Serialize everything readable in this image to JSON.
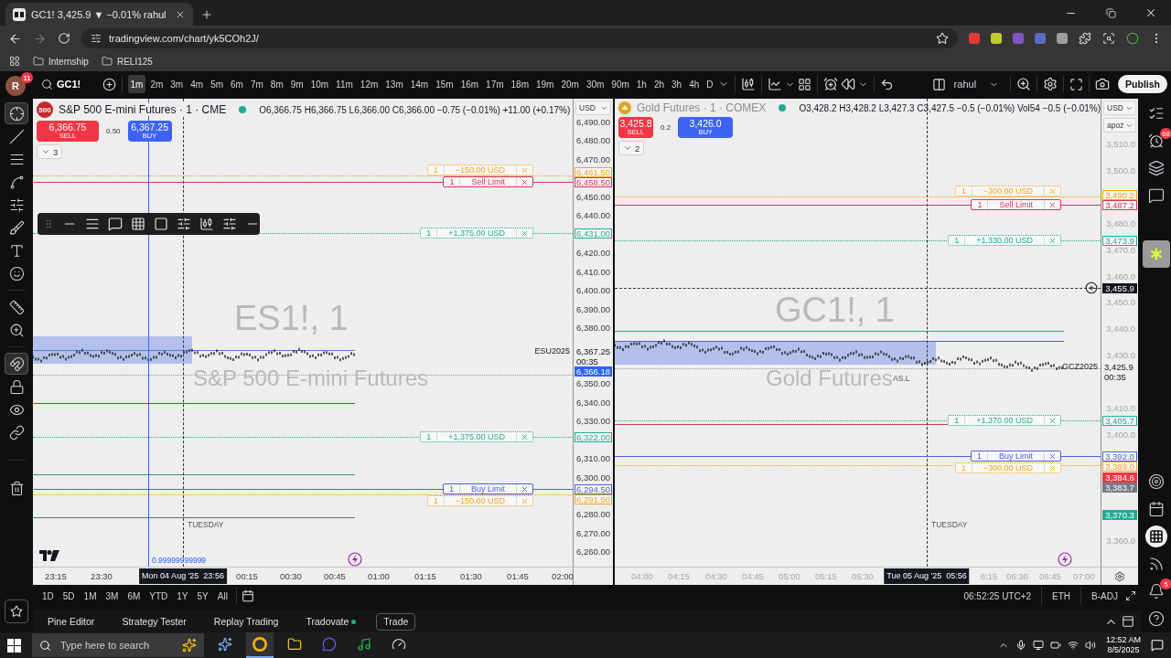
{
  "browser": {
    "tab": {
      "title": "GC1! 3,425.9 ▼ −0.01% rahul"
    },
    "url": "tradingview.com/chart/yk5COh2J/",
    "bookmarks": [
      {
        "label": "Internship"
      },
      {
        "label": "RELI125"
      }
    ]
  },
  "toolbar": {
    "avatar": "R",
    "avatar_badge": "11",
    "symbol": "GC1!",
    "layout_name": "rahul",
    "publish": "Publish",
    "intervals": [
      {
        "label": "1m",
        "selected": true
      },
      {
        "label": "2m",
        "selected": false
      },
      {
        "label": "3m",
        "selected": false
      },
      {
        "label": "4m",
        "selected": false
      },
      {
        "label": "5m",
        "selected": false
      },
      {
        "label": "6m",
        "selected": false
      },
      {
        "label": "7m",
        "selected": false
      },
      {
        "label": "8m",
        "selected": false
      },
      {
        "label": "9m",
        "selected": false
      },
      {
        "label": "10m",
        "selected": false
      },
      {
        "label": "11m",
        "selected": false
      },
      {
        "label": "12m",
        "selected": false
      },
      {
        "label": "13m",
        "selected": false
      },
      {
        "label": "14m",
        "selected": false
      },
      {
        "label": "15m",
        "selected": false
      },
      {
        "label": "16m",
        "selected": false
      },
      {
        "label": "17m",
        "selected": false
      },
      {
        "label": "18m",
        "selected": false
      },
      {
        "label": "19m",
        "selected": false
      },
      {
        "label": "20m",
        "selected": false
      },
      {
        "label": "30m",
        "selected": false
      },
      {
        "label": "90m",
        "selected": false
      },
      {
        "label": "1h",
        "selected": false
      },
      {
        "label": "2h",
        "selected": false
      },
      {
        "label": "3h",
        "selected": false
      },
      {
        "label": "4h",
        "selected": false
      },
      {
        "label": "D",
        "selected": false
      }
    ]
  },
  "drawing_tools": [
    {
      "kind": "crosshair",
      "selected": true
    },
    {
      "kind": "trend-line",
      "selected": false
    },
    {
      "kind": "channels",
      "selected": false
    },
    {
      "kind": "pattern",
      "selected": false
    },
    {
      "kind": "position",
      "selected": false
    },
    {
      "kind": "brush",
      "selected": false
    },
    {
      "kind": "text",
      "selected": false
    },
    {
      "kind": "emoji",
      "selected": false
    },
    {
      "kind": "ruler",
      "selected": false
    },
    {
      "kind": "zoom",
      "selected": false
    },
    {
      "kind": "magnet",
      "selected": true
    },
    {
      "kind": "lock",
      "selected": false
    },
    {
      "kind": "eye",
      "selected": false
    },
    {
      "kind": "link",
      "selected": false
    },
    {
      "kind": "trash",
      "selected": false
    }
  ],
  "right_sidebar": [
    {
      "kind": "watchlist",
      "selected": false
    },
    {
      "kind": "alerts",
      "badge": "68",
      "selected": false
    },
    {
      "kind": "layers",
      "selected": false
    },
    {
      "kind": "chat",
      "selected": false
    },
    {
      "kind": "app",
      "selected": true
    },
    {
      "kind": "target",
      "selected": false
    },
    {
      "kind": "calendar",
      "selected": false
    },
    {
      "kind": "apps",
      "selected": false
    },
    {
      "kind": "signal",
      "selected": false
    },
    {
      "kind": "notifications",
      "badge": "5",
      "selected": false
    },
    {
      "kind": "help",
      "selected": false
    }
  ],
  "charts": [
    {
      "active": true,
      "logo": "500",
      "title": "S&P 500 E-mini Futures · 1 · CME",
      "market_open": true,
      "ohlc": "O6,366.75 H6,366.75 L6,366.00 C6,366.00 −0.75 (−0.01%) +11.00 (+0.17%)",
      "sell": {
        "price": "6,366.75",
        "label": "SELL"
      },
      "spread": "0.50",
      "buy": {
        "price": "6,367.25",
        "label": "BUY"
      },
      "indicator_count": "3",
      "axis_menus": [
        "USD"
      ],
      "watermark": {
        "symbol": "ES1!, 1",
        "name": "S&P 500 E-mini Futures"
      },
      "price_ticks": [
        "6,490.00",
        "6,480.00",
        "6,470.00",
        "6,450.00",
        "6,440.00",
        "6,420.00",
        "6,410.00",
        "6,400.00",
        "6,390.00",
        "6,380.00",
        "6,350.00",
        "6,340.00",
        "6,330.00",
        "6,310.00",
        "6,300.00",
        "6,280.00",
        "6,270.00",
        "6,260.00"
      ],
      "price_tags": [
        {
          "text": "6,461.50",
          "color": "#f7a21b",
          "filled": false
        },
        {
          "text": "6,458.50",
          "color": "#d8365a",
          "filled": false
        },
        {
          "text": "6,431.00",
          "color": "#22ab94",
          "filled": false
        },
        {
          "text": "6,366.18",
          "color": "#2962ff",
          "filled": true
        },
        {
          "text": "6,322.00",
          "color": "#22ab94",
          "filled": false
        },
        {
          "text": "6,294.50",
          "color": "#4a64d6",
          "filled": false
        },
        {
          "text": "6,291.50",
          "color": "#f7a21b",
          "filled": false
        }
      ],
      "last_price": {
        "symbol": "ESU2025",
        "price": "6,367.25",
        "countdown": "00:35"
      },
      "orders": [
        {
          "kind": "bracket",
          "quantity": "1",
          "text": "−150.00 USD",
          "color": "#f7a21b"
        },
        {
          "kind": "limit",
          "quantity": "1",
          "text": "Sell Limit",
          "color": "#d8365a"
        },
        {
          "kind": "bracket",
          "quantity": "1",
          "text": "+1,375.00 USD",
          "color": "#22ab94"
        },
        {
          "kind": "bracket",
          "quantity": "1",
          "text": "+1,375.00 USD",
          "color": "#22ab94"
        },
        {
          "kind": "limit",
          "quantity": "1",
          "text": "Buy Limit",
          "color": "#4a64d6"
        },
        {
          "kind": "bracket",
          "quantity": "1",
          "text": "−150.00 USD",
          "color": "#f7a21b"
        }
      ],
      "notes": [
        {
          "kind": "label",
          "text": "TUESDAY"
        },
        {
          "kind": "level",
          "text": "0.99999999999"
        }
      ],
      "time_ticks": [
        "23:15",
        "23:30",
        "00:15",
        "00:30",
        "00:45",
        "01:00",
        "01:15",
        "01:30",
        "01:45",
        "02:00"
      ],
      "crosshair_time": "Mon 04 Aug '25  23:56"
    },
    {
      "active": false,
      "title": "Gold Futures · 1 · COMEX",
      "market_open": true,
      "ohlc": "O3,428.2 H3,428.2 L3,427.3 C3,427.5 −0.5 (−0.01%) Vol54 −0.5 (−0.01%)",
      "sell": {
        "price": "3,425.8",
        "label": "SELL"
      },
      "spread": "0.2",
      "buy": {
        "price": "3,426.0",
        "label": "BUY"
      },
      "indicator_count": "2",
      "axis_menus": [
        "USD",
        "apoz"
      ],
      "watermark": {
        "symbol": "GC1!, 1",
        "name": "Gold Futures"
      },
      "price_ticks": [
        "3,510.0",
        "3,500.0",
        "3,480.0",
        "3,470.0",
        "3,460.0",
        "3,450.0",
        "3,440.0",
        "3,430.0",
        "3,410.0",
        "3,400.0",
        "3,360.0"
      ],
      "price_tags": [
        {
          "text": "3,490.2",
          "color": "#f7a21b",
          "filled": false
        },
        {
          "text": "3,487.2",
          "color": "#d8365a",
          "filled": false
        },
        {
          "text": "3,473.9",
          "color": "#22ab94",
          "filled": false
        },
        {
          "text": "3,455.9",
          "color": "#131722",
          "filled": true
        },
        {
          "text": "3,405.7",
          "color": "#22ab94",
          "filled": false
        },
        {
          "text": "3,392.0",
          "color": "#4a64d6",
          "filled": false
        },
        {
          "text": "3,389.0",
          "color": "#f7a21b",
          "filled": false
        },
        {
          "text": "3,384.6",
          "color": "#f23645",
          "filled": true
        },
        {
          "text": "3,383.7",
          "color": "#787b86",
          "filled": true
        },
        {
          "text": "3,370.3",
          "color": "#22ab94",
          "filled": true
        }
      ],
      "last_price": {
        "symbol": "GCZ2025",
        "price": "3,425.9",
        "countdown": "00:35"
      },
      "orders": [
        {
          "kind": "bracket",
          "quantity": "1",
          "text": "−300.00 USD",
          "color": "#f7a21b"
        },
        {
          "kind": "limit",
          "quantity": "1",
          "text": "Sell Limit",
          "color": "#d8365a"
        },
        {
          "kind": "bracket",
          "quantity": "1",
          "text": "+1,330.00 USD",
          "color": "#22ab94"
        },
        {
          "kind": "bracket",
          "quantity": "1",
          "text": "+1,370.00 USD",
          "color": "#22ab94"
        },
        {
          "kind": "limit",
          "quantity": "1",
          "text": "Buy Limit",
          "color": "#4a64d6"
        },
        {
          "kind": "bracket",
          "quantity": "1",
          "text": "−300.00 USD",
          "color": "#f7a21b"
        }
      ],
      "notes": [
        {
          "kind": "label",
          "text": "AS.L"
        },
        {
          "kind": "label",
          "text": "TUESDAY"
        }
      ],
      "time_ticks": [
        "04:00",
        "04:15",
        "04:30",
        "04:45",
        "05:00",
        "05:15",
        "05:30",
        "6:15",
        "06:30",
        "06:45",
        "07:00"
      ],
      "crosshair_time": "Tue 05 Aug '25  05:56"
    }
  ],
  "ranges": [
    "1D",
    "5D",
    "1M",
    "3M",
    "6M",
    "YTD",
    "1Y",
    "5Y",
    "All"
  ],
  "status": {
    "clock": "06:52:25 UTC+2",
    "session": "ETH",
    "adjustment": "B-ADJ"
  },
  "panel_tabs": [
    {
      "label": "Pine Editor",
      "selected": false,
      "connected": false
    },
    {
      "label": "Strategy Tester",
      "selected": false,
      "connected": false
    },
    {
      "label": "Replay Trading",
      "selected": false,
      "connected": false
    },
    {
      "label": "Tradovate",
      "selected": false,
      "connected": true
    },
    {
      "label": "Trade",
      "selected": true,
      "connected": false
    }
  ],
  "taskbar": {
    "search_placeholder": "Type here to search",
    "time": "12:52 AM",
    "date": "8/5/2025"
  }
}
